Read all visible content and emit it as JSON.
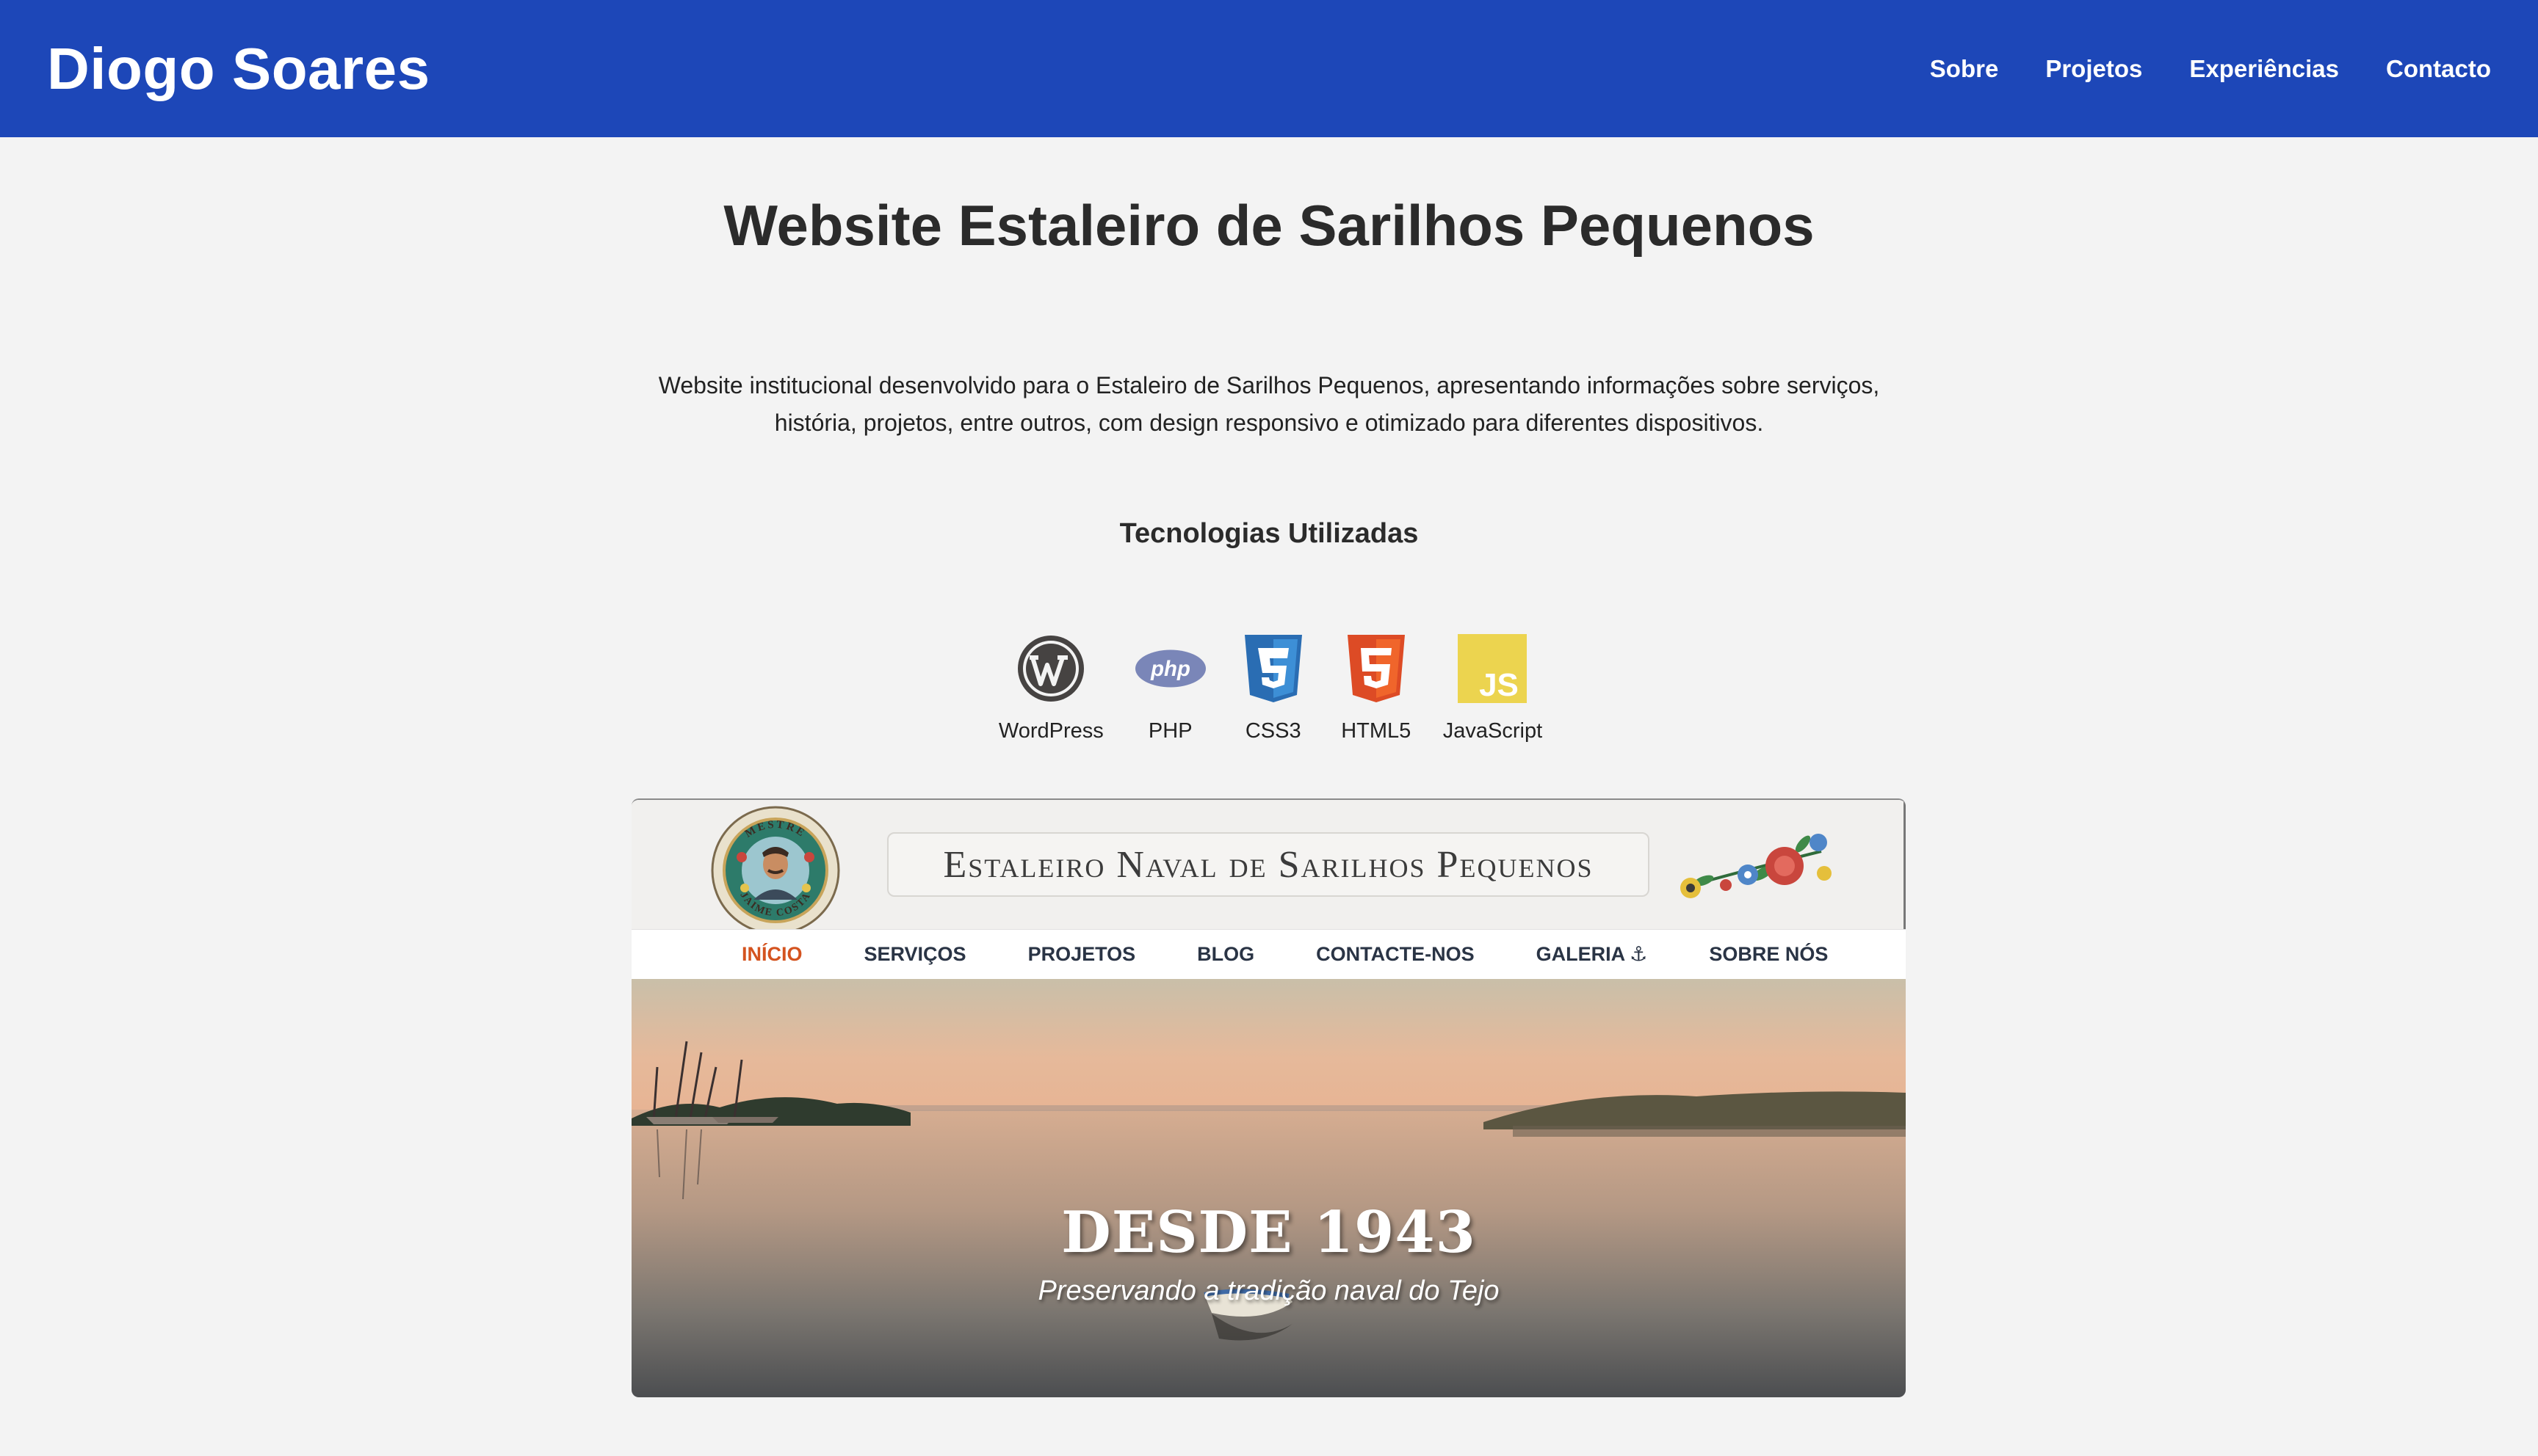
{
  "header": {
    "brand": "Diogo Soares",
    "nav": [
      "Sobre",
      "Projetos",
      "Experiências",
      "Contacto"
    ],
    "background_color": "#1d47b8"
  },
  "main": {
    "title": "Website Estaleiro de Sarilhos Pequenos",
    "description": "Website institucional desenvolvido para o Estaleiro de Sarilhos Pequenos, apresentando informações sobre serviços, história, projetos, entre outros, com design responsivo e otimizado para diferentes dispositivos.",
    "technologies_heading": "Tecnologias Utilizadas",
    "technologies": [
      {
        "label": "WordPress",
        "icon": "wordpress-icon"
      },
      {
        "label": "PHP",
        "icon": "php-icon"
      },
      {
        "label": "CSS3",
        "icon": "css3-icon"
      },
      {
        "label": "HTML5",
        "icon": "html5-icon"
      },
      {
        "label": "JavaScript",
        "icon": "javascript-icon"
      }
    ]
  },
  "preview": {
    "seal_top_text": "MESTRE",
    "seal_bottom_text": "JAIME COSTA",
    "site_title": "Estaleiro Naval de Sarilhos Pequenos",
    "nav": [
      "INÍCIO",
      "SERVIÇOS",
      "PROJETOS",
      "BLOG",
      "CONTACTE-NOS",
      "GALERIA",
      "SOBRE NÓS"
    ],
    "nav_active": "INÍCIO",
    "nav_anchor_glyph": "⚓",
    "hero_title": "DESDE 1943",
    "hero_subtitle": "Preservando a tradição naval do Tejo",
    "accent_color": "#d4531f"
  }
}
